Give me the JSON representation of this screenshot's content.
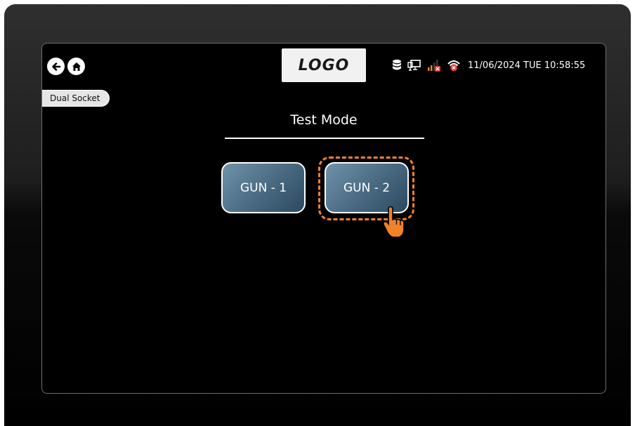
{
  "header": {
    "back_icon": "arrow-left-circle-icon",
    "home_icon": "home-icon",
    "logo_text": "LOGO",
    "status_icons": [
      "database-icon",
      "network-icon",
      "signal-error-icon",
      "wifi-error-icon"
    ],
    "datetime": "11/06/2024 TUE 10:58:55"
  },
  "mode_pill": {
    "label": "Dual Socket"
  },
  "main": {
    "title": "Test Mode",
    "buttons": [
      {
        "label": "GUN - 1",
        "selected": false
      },
      {
        "label": "GUN - 2",
        "selected": true
      }
    ]
  },
  "colors": {
    "highlight": "#f0822a",
    "button_gradient_start": "#6f93aa",
    "button_gradient_end": "#2b4a60",
    "screen_background": "#000000",
    "error_red": "#e53935"
  }
}
